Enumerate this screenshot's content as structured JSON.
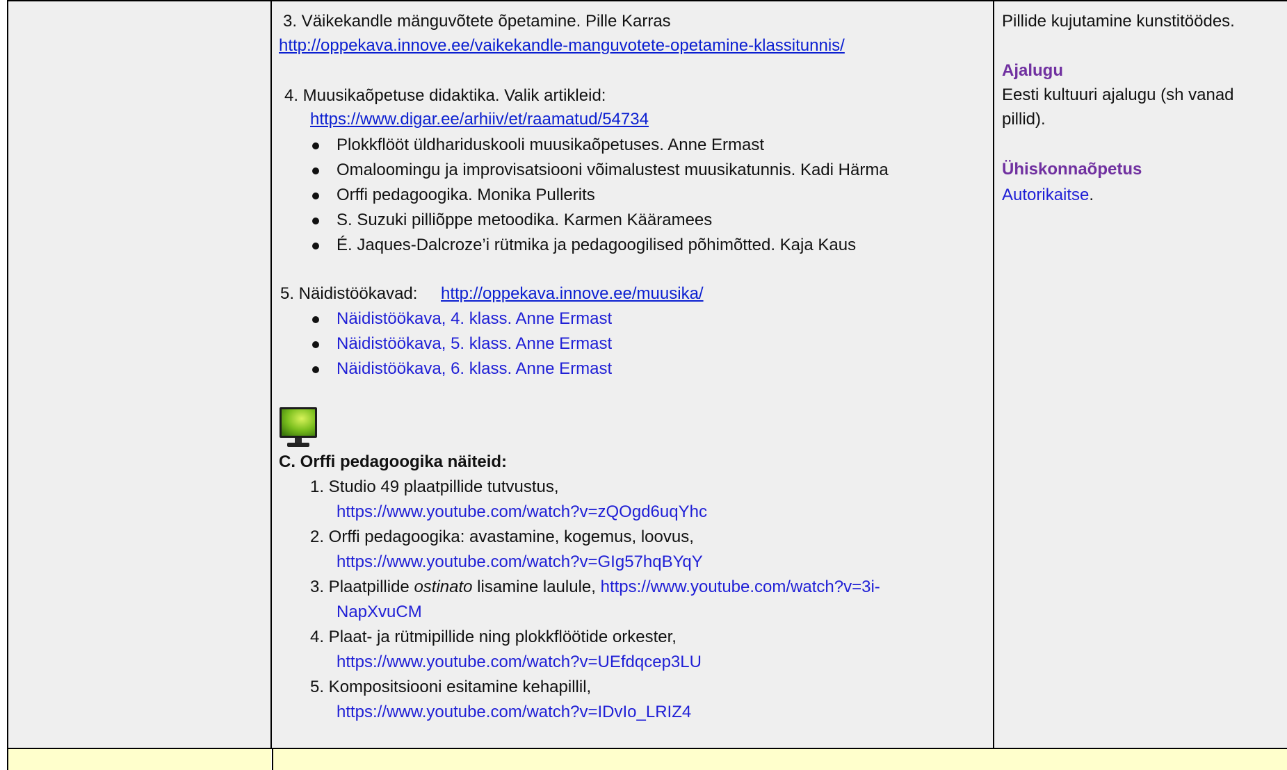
{
  "mid": {
    "item3": {
      "title": "3. Väikekandle mänguvõtete õpetamine. Pille Karras",
      "url": "http://oppekava.innove.ee/vaikekandle-manguvotete-opetamine-klassitunnis/"
    },
    "item4": {
      "title": "4. Muusikaõpetuse didaktika. Valik artikleid:",
      "url": "https://www.digar.ee/arhiiv/et/raamatud/54734",
      "bullets": [
        "Plokkflööt üldhariduskooli muusikaõpetuses. Anne Ermast",
        "Omaloomingu ja improvisatsiooni võimalustest muusikatunnis. Kadi Härma",
        "Orffi pedagoogika. Monika Pullerits",
        "S. Suzuki pilliõppe metoodika. Karmen Kääramees",
        "É. Jaques-Dalcroze’i rütmika ja pedagoogilised põhimõtted. Kaja Kaus"
      ]
    },
    "item5": {
      "label": "5. Näidistöökavad:",
      "url": "http://oppekava.innove.ee/muusika/",
      "bullets": [
        "Näidistöökava, 4. klass. Anne Ermast",
        "Näidistöökava, 5. klass. Anne Ermast",
        "Näidistöökava, 6. klass. Anne Ermast"
      ]
    },
    "sectionC": {
      "icon": "monitor-icon",
      "title": "C. Orffi pedagoogika näiteid:",
      "items": [
        {
          "text": "1. Studio 49 plaatpillide tutvustus,",
          "url": "https://www.youtube.com/watch?v=zQOgd6uqYhc"
        },
        {
          "text": "2. Orffi pedagoogika: avastamine, kogemus, loovus,",
          "url": "https://www.youtube.com/watch?v=GIg57hqBYqY"
        },
        {
          "text_pre": "3. Plaatpillide ",
          "text_em": "ostinato",
          "text_post": " lisamine laulule,",
          "url_part1": "https://www.youtube.com/watch?v=3i-",
          "url_part2": "NapXvuCM"
        },
        {
          "text": "4. Plaat- ja rütmipillide ning plokkflöötide orkester,",
          "url": "https://www.youtube.com/watch?v=UEfdqcep3LU"
        },
        {
          "text": "5. Kompositsiooni esitamine kehapillil,",
          "url": "https://www.youtube.com/watch?v=IDvIo_LRIZ4"
        }
      ]
    }
  },
  "right": {
    "intro": "Pillide kujutamine kunstitöödes.",
    "history_heading": "Ajalugu",
    "history_line1": "Eesti kultuuri ajalugu (sh vanad",
    "history_line2": "pillid).",
    "social_heading": "Ühiskonnaõpetus",
    "social_link": "Autorikaitse",
    "social_period": "."
  },
  "colors": {
    "link": "#0b1fd1",
    "purple": "#7030a0",
    "cellGray": "#efefef",
    "rowYellow": "#ffffcc"
  }
}
